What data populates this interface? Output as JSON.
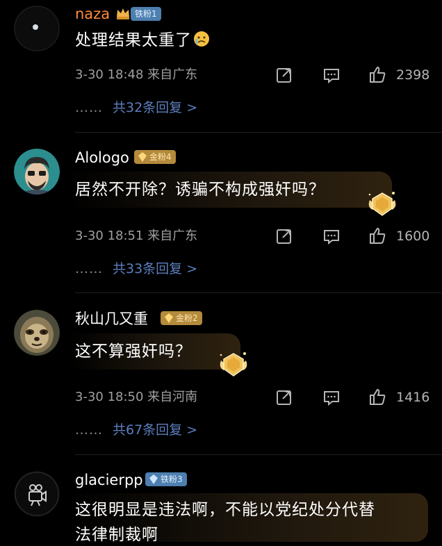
{
  "comments": [
    {
      "username": "naza",
      "badge": "铁粉1",
      "badge_color": "#4d7fb0",
      "text": "处理结果太重了",
      "emoji": "crying-face-icon",
      "meta": "3-30 18:48 来自广东",
      "likes": "2398",
      "replies": "共32条回复 >"
    },
    {
      "username": "Alologo",
      "badge": "金粉4",
      "badge_color": "#b48a3c",
      "text": "居然不开除？诱骗不构成强奸吗？",
      "meta": "3-30 18:51 来自广东",
      "likes": "1600",
      "replies": "共33条回复 >"
    },
    {
      "username": "秋山几又重",
      "badge": "金粉2",
      "badge_color": "#b48a3c",
      "text": "这不算强奸吗？",
      "meta": "3-30 18:50 来自河南",
      "likes": "1416",
      "replies": "共67条回复 >"
    },
    {
      "username": "glacierpp",
      "badge": "铁粉3",
      "badge_color": "#4d7fb0",
      "text_line1": "这很明显是违法啊，不能以党纪处分代替",
      "text_line2": "法律制裁啊"
    }
  ],
  "ui": {
    "reply_dots": "……",
    "accent": "#5d7fbf"
  }
}
